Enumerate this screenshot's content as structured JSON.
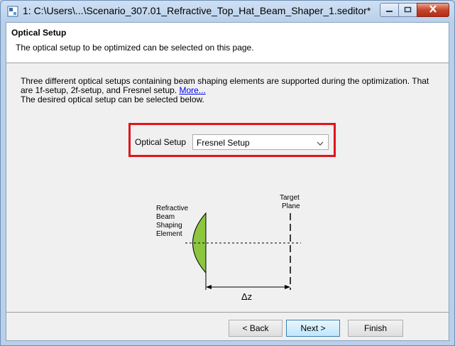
{
  "window": {
    "title": "1: C:\\Users\\...\\Scenario_307.01_Refractive_Top_Hat_Beam_Shaper_1.seditor*",
    "icons": {
      "app": "document-icon",
      "minimize": "minimize-icon",
      "maximize": "maximize-icon",
      "close": "close-icon"
    }
  },
  "header": {
    "title": "Optical Setup",
    "subtitle": "The optical setup to be optimized can be selected on this page."
  },
  "description": {
    "line1": "Three different optical setups containing beam shaping elements are supported during the optimization. That",
    "line2_prefix": "are 1f-setup, 2f-setup, and Fresnel setup. ",
    "more_link": "More...",
    "line3": "The desired optical setup can be selected below."
  },
  "setup": {
    "label": "Optical Setup",
    "selected": "Fresnel Setup"
  },
  "diagram": {
    "element_label": [
      "Refractive",
      "Beam",
      "Shaping",
      "Element"
    ],
    "target_label": [
      "Target",
      "Plane"
    ],
    "distance_label": "Δz",
    "lens_color": "#8cc63f"
  },
  "buttons": {
    "back": "< Back",
    "next": "Next >",
    "finish": "Finish"
  },
  "colors": {
    "highlight": "#e0141c",
    "link": "#0000ee"
  }
}
